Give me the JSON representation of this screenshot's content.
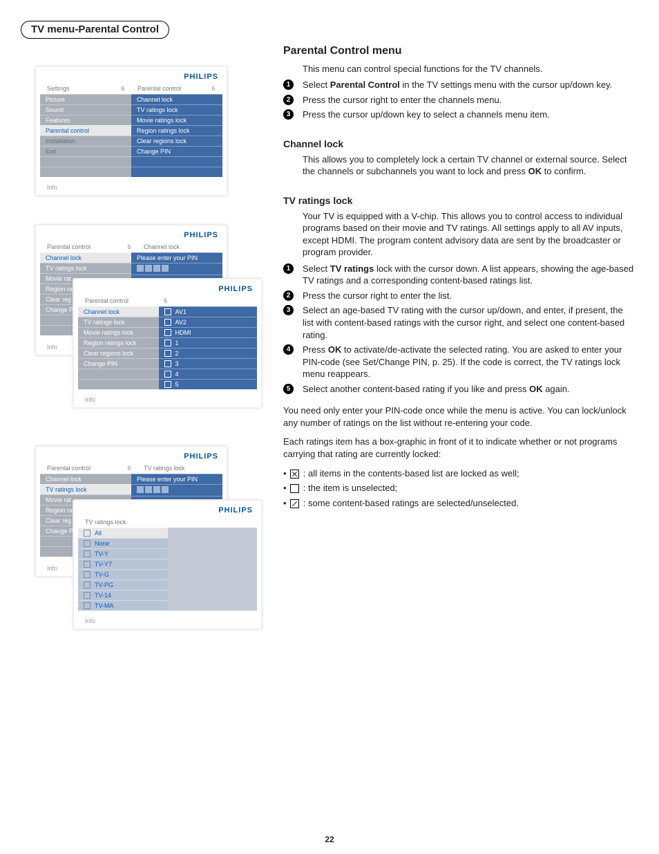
{
  "page_title": "TV menu-Parental Control",
  "page_number": "22",
  "brand": "PHILIPS",
  "info_label": "Info",
  "screenshot1": {
    "left_header": "Settings",
    "right_header": "Parental control",
    "num": "6",
    "left_items": [
      "Picture",
      "Sound",
      "Features",
      "Parental control",
      "Installation",
      "Exit"
    ],
    "left_selected_index": 3,
    "right_items": [
      "Channel lock",
      "TV ratings lock",
      "Movie ratings lock",
      "Region ratings lock",
      "Clear regions lock",
      "Change PIN"
    ]
  },
  "screenshot2_base": {
    "left_header": "Parental control",
    "right_header": "Channel lock",
    "num": "6",
    "left_items": [
      "Channel lock",
      "TV ratings lock",
      "Movie rat",
      "Region ra",
      "Clear reg",
      "Change P"
    ],
    "left_selected_index": 0,
    "pin_prompt": "Please enter your PIN"
  },
  "screenshot2_overlay": {
    "left_header": "Parental control",
    "num": "6",
    "left_items": [
      "Channel lock",
      "TV ratings lock",
      "Movie ratings lock",
      "Region ratings lock",
      "Clear regions lock",
      "Change PIN"
    ],
    "left_selected_index": 0,
    "right_items": [
      "AV1",
      "AV2",
      "HDMI",
      "1",
      "2",
      "3",
      "4",
      "5"
    ]
  },
  "screenshot3_base": {
    "left_header": "Parental control",
    "right_header": "TV ratings lock",
    "num": "6",
    "left_items": [
      "Channel lock",
      "TV ratings lock",
      "Movie rat",
      "Region ra",
      "Clear reg",
      "Change P"
    ],
    "left_selected_index": 1,
    "pin_prompt": "Please enter your PIN"
  },
  "screenshot3_overlay": {
    "left_header": "TV ratings lock",
    "left_items": [
      "All",
      "None",
      "TV-Y",
      "TV-Y7",
      "TV-G",
      "TV-PG",
      "TV-14",
      "TV-MA"
    ],
    "left_selected_index": 0
  },
  "content": {
    "h_parental": "Parental Control menu",
    "parental_intro": "This menu can control special functions for the TV channels.",
    "parental_steps": [
      {
        "pre": "Select ",
        "bold": "Parental Control",
        "post": " in the TV settings menu with the cursor up/down key."
      },
      {
        "pre": "Press the cursor right to enter the channels menu.",
        "bold": "",
        "post": ""
      },
      {
        "pre": "Press the cursor up/down key to select a channels menu item.",
        "bold": "",
        "post": ""
      }
    ],
    "h_channel": "Channel lock",
    "channel_body_pre": "This allows you to completely lock a certain TV channel or external source. Select the channels or subchannels you want to lock and press ",
    "channel_body_bold": "OK",
    "channel_body_post": " to confirm.",
    "h_tvr": "TV ratings lock",
    "tvr_intro": "Your TV is equipped with a V-chip. This allows you to control access to individual programs based on their movie and TV ratings. All settings apply to all AV inputs, except HDMI. The program content advisory data are sent by the broadcaster or program provider.",
    "tvr_steps": [
      {
        "pre": "Select ",
        "bold": "TV ratings",
        "post": " lock with the cursor down. A list appears, showing the age-based TV ratings and a corresponding content-based ratings list."
      },
      {
        "pre": "Press the cursor right to enter the list.",
        "bold": "",
        "post": ""
      },
      {
        "pre": "Select an age-based TV rating with the cursor up/down, and enter, if present, the list with content-based ratings with the cursor right, and select one content-based rating.",
        "bold": "",
        "post": ""
      },
      {
        "pre": "Press ",
        "bold": "OK",
        "post": " to activate/de-activate the selected rating. You are asked to enter your PIN-code (see Set/Change PIN, p. 25). If the code is correct, the TV ratings lock menu reappears."
      },
      {
        "pre": "Select another content-based rating if you like and press ",
        "bold": "OK",
        "post": " again."
      }
    ],
    "para1": "You need only enter your PIN-code once while the menu is active. You can lock/unlock any number of ratings on the list without re-entering your code.",
    "para2": "Each ratings item has a box-graphic in front of it to indicate whether or not programs carrying that rating are currently locked:",
    "legend_x": " : all items in the contents-based list are locked as well;",
    "legend_empty": " : the item is unselected;",
    "legend_slash": " : some content-based ratings are selected/unselected."
  }
}
